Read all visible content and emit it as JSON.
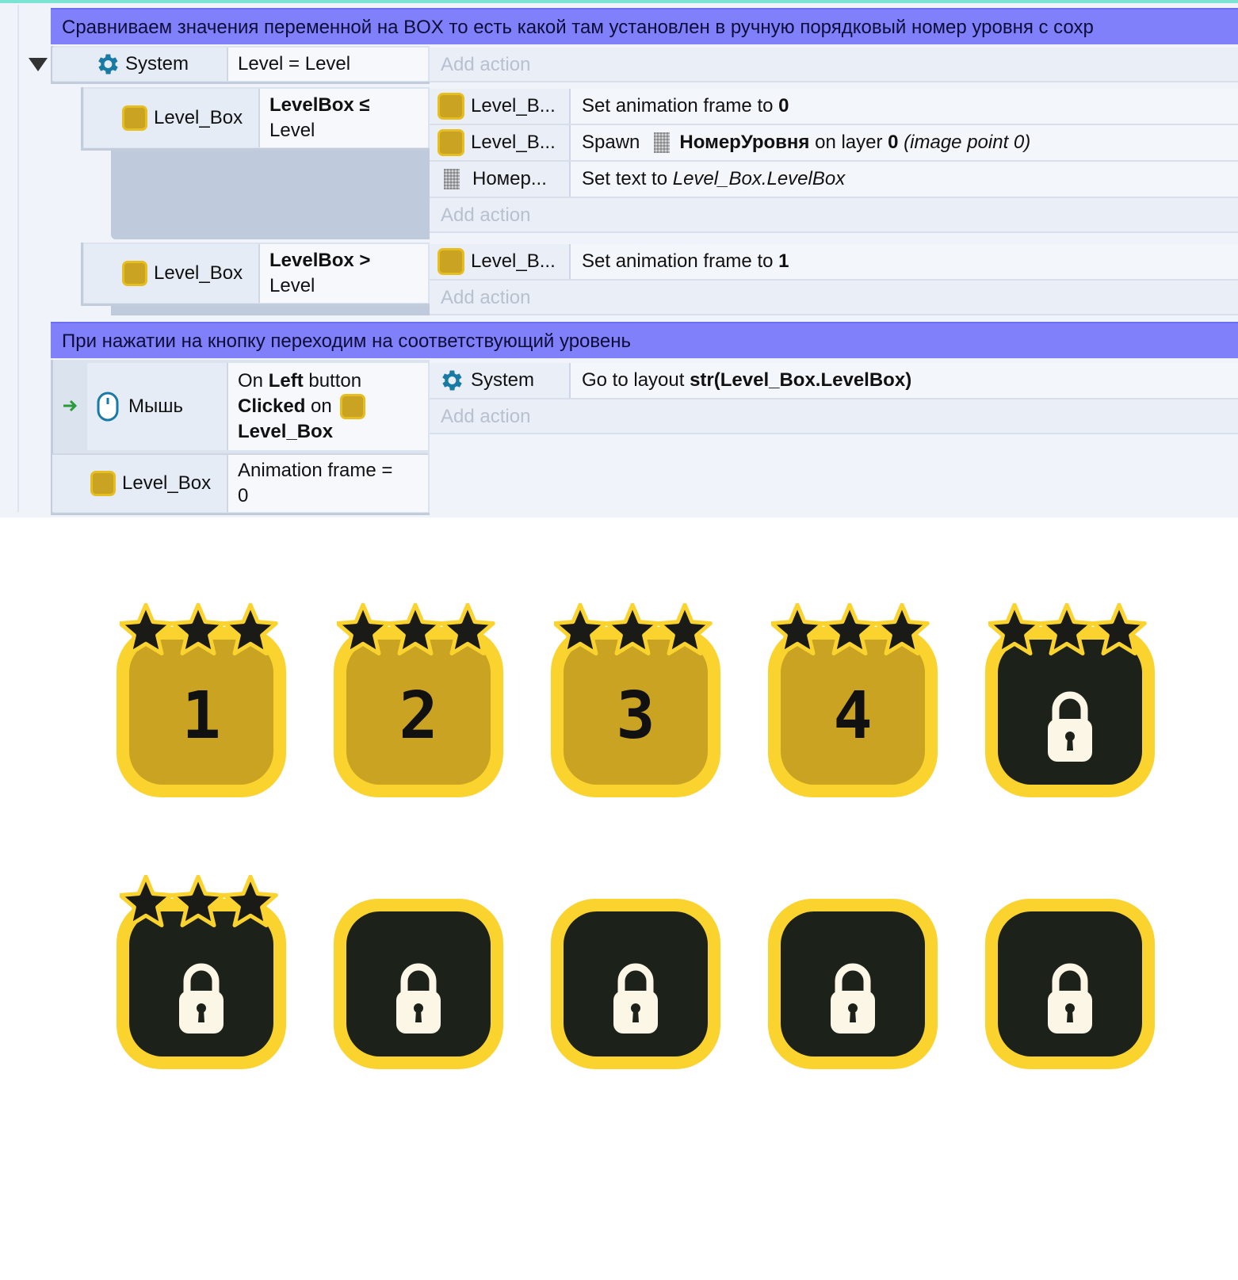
{
  "sheet": {
    "comment1": "Сравниваем значения переменной на BOX то есть какой там установлен в ручную порядковый номер уровня с сохр",
    "comment2": "При нажатии на кнопку переходим на соответствующий уровень",
    "event1": {
      "object": "System",
      "condition": "Level = Level",
      "add_action": "Add action"
    },
    "sub1": {
      "object": "Level_Box",
      "condition_bold": "LevelBox ≤",
      "condition_rest": "Level",
      "actions": [
        {
          "object": "Level_B...",
          "pre": "Set animation frame to ",
          "bold": "0"
        },
        {
          "object": "Level_B...",
          "pre": "Spawn",
          "bold": "НомерУровня",
          "mid": " on layer ",
          "bold2": "0",
          "italic": " (image point 0)"
        },
        {
          "object": "Номер...",
          "pre": "Set text to ",
          "italic": "Level_Box.LevelBox"
        }
      ],
      "add_action": "Add action"
    },
    "sub2": {
      "object": "Level_Box",
      "condition_bold": "LevelBox >",
      "condition_rest": "Level",
      "actions": [
        {
          "object": "Level_B...",
          "pre": "Set animation frame to ",
          "bold": "1"
        }
      ],
      "add_action": "Add action"
    },
    "event2": {
      "object1": "Мышь",
      "cond1_pre": "On ",
      "cond1_bold": "Left",
      "cond1_rest": " button",
      "cond1_bold2": "Clicked",
      "cond1_on": " on",
      "cond1_obj": "Level_Box",
      "object2": "Level_Box",
      "cond2": "Animation frame =",
      "cond2_val": "0",
      "action_object": "System",
      "action_pre": "Go to layout ",
      "action_bold": "str(Level_Box.LevelBox)",
      "add_action": "Add action"
    }
  },
  "levels": [
    {
      "label": "1",
      "state": "unlocked",
      "stars": 3
    },
    {
      "label": "2",
      "state": "unlocked",
      "stars": 3
    },
    {
      "label": "3",
      "state": "unlocked",
      "stars": 3
    },
    {
      "label": "4",
      "state": "unlocked",
      "stars": 3
    },
    {
      "label": "",
      "state": "locked",
      "stars": 3
    },
    {
      "label": "",
      "state": "locked",
      "stars": 3
    },
    {
      "label": "",
      "state": "locked",
      "stars": 0
    },
    {
      "label": "",
      "state": "locked",
      "stars": 0
    },
    {
      "label": "",
      "state": "locked",
      "stars": 0
    },
    {
      "label": "",
      "state": "locked",
      "stars": 0
    }
  ],
  "colors": {
    "comment_bg": "#8081fa",
    "box_frame": "#fbd32e",
    "box_unlocked": "#c9a321",
    "box_locked": "#1c2119",
    "star": "#1a1a16",
    "lock_body": "#fbf6e6"
  }
}
